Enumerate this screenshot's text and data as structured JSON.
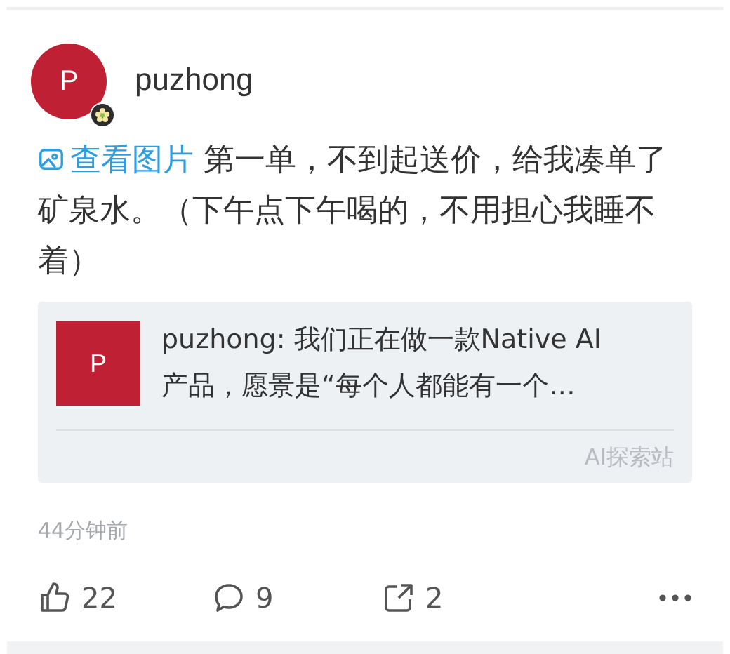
{
  "post": {
    "author": {
      "initial": "P",
      "name": "puzhong",
      "badge": true
    },
    "image_link": "查看图片",
    "text": "第一单，不到起送价，给我凑单了矿泉水。（下午点下午喝的，不用担心我睡不着）",
    "quote": {
      "initial": "P",
      "lines": [
        "puzhong: 我们正在做一款Native AI",
        "产品，愿景是“每个人都能有一个…"
      ],
      "source": "AI探索站"
    },
    "time": "44分钟前",
    "actions": [
      {
        "kind": "like",
        "count": "22"
      },
      {
        "kind": "comment",
        "count": "9"
      },
      {
        "kind": "share",
        "count": "2"
      },
      {
        "kind": "more"
      }
    ]
  }
}
